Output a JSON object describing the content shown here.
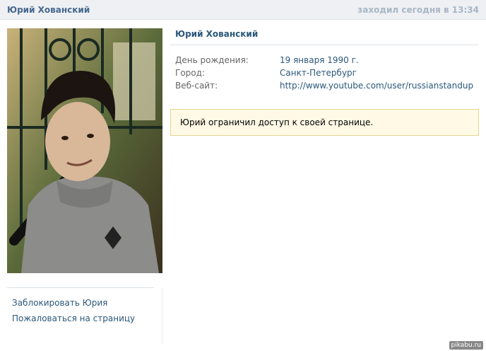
{
  "header": {
    "name": "Юрий Хованский",
    "last_seen": "заходил сегодня в 13:34"
  },
  "profile": {
    "name": "Юрий Хованский",
    "info": [
      {
        "label": "День рождения:",
        "value": "19 января 1990 г."
      },
      {
        "label": "Город:",
        "value": "Санкт-Петербург"
      },
      {
        "label": "Веб-сайт:",
        "value": "http://www.youtube.com/user/russianstandup"
      }
    ],
    "notice": "Юрий ограничил доступ к своей странице."
  },
  "actions": {
    "block": "Заблокировать Юрия",
    "report": "Пожаловаться на страницу"
  },
  "watermark": "pikabu.ru",
  "colors": {
    "link": "#2b587a",
    "header_bg": "#eef0f3",
    "notice_bg": "#fff9e5",
    "notice_border": "#e4d48f"
  }
}
